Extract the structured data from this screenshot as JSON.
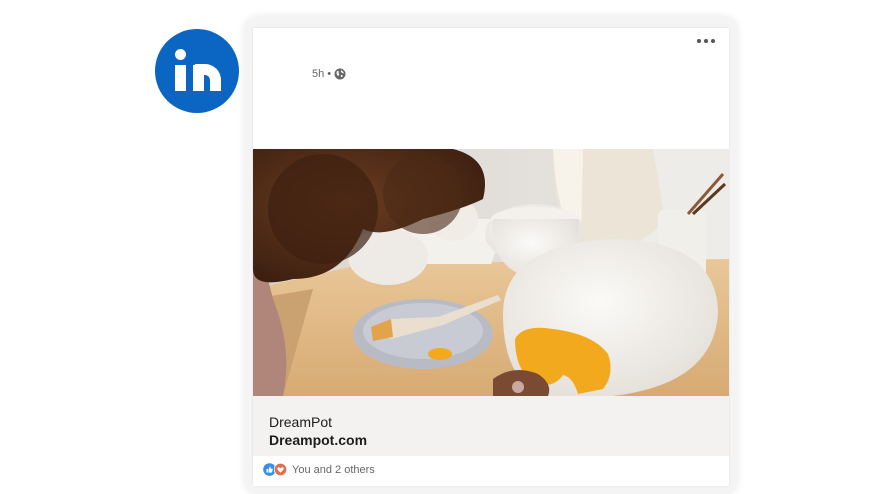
{
  "brand": {
    "logo_text": "in"
  },
  "post": {
    "time": "5h",
    "separator": "•",
    "more_icon": "more-horizontal-icon",
    "visibility_icon": "globe-icon",
    "link": {
      "title": "DreamPot",
      "url": "Dreampot.com"
    },
    "reactions": {
      "text": "You and 2 others",
      "icons": [
        "like-icon",
        "love-icon"
      ]
    }
  },
  "colors": {
    "linkedin_blue": "#0a66c2",
    "link_bar": "#f3f2f1",
    "love_red": "#df704d",
    "paint_yellow": "#f2a91d"
  }
}
